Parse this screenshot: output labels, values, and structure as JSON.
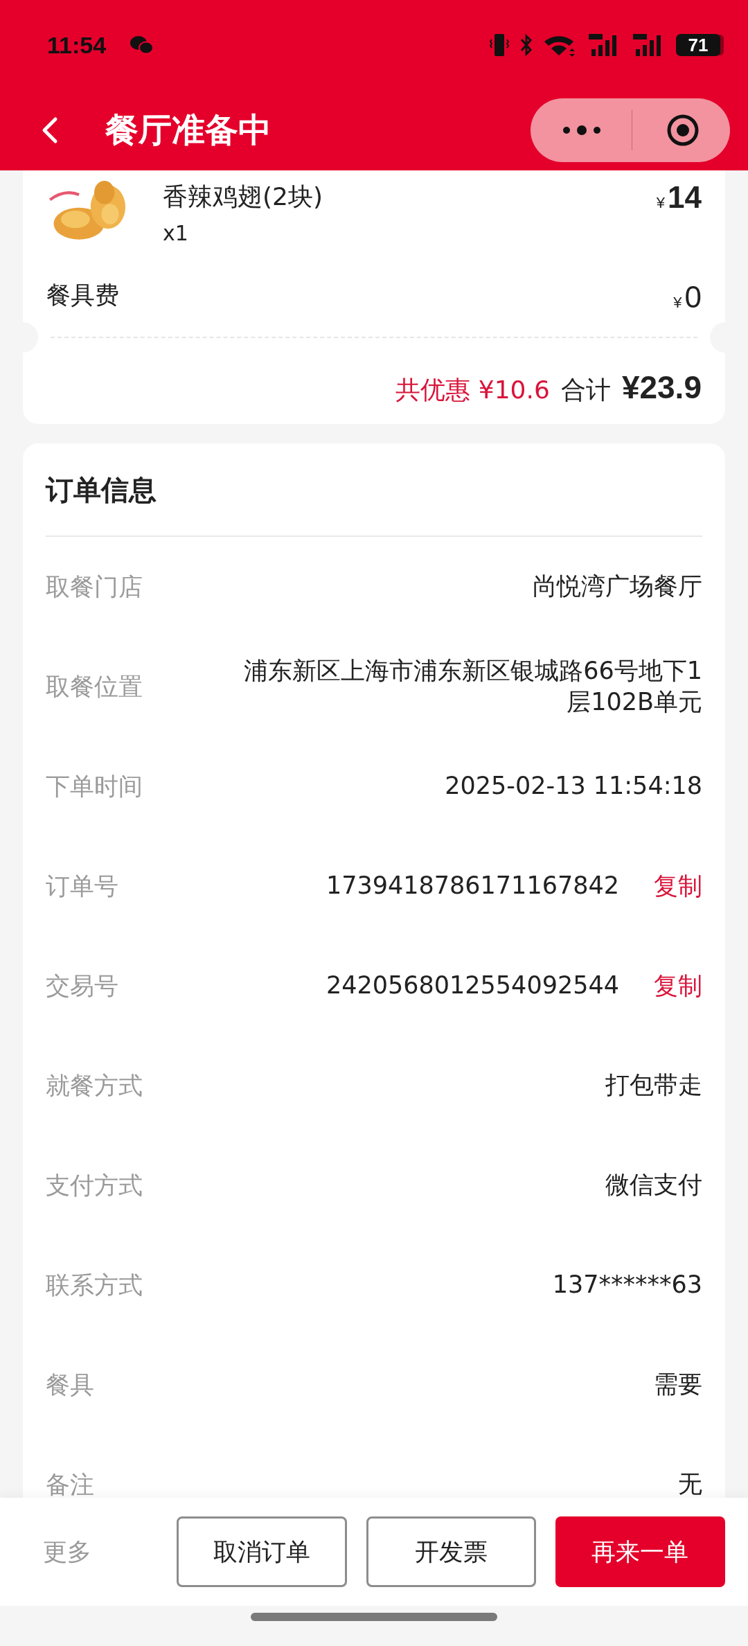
{
  "status_bar": {
    "time": "11:54",
    "battery": "71"
  },
  "nav": {
    "title": "餐厅准备中"
  },
  "items": [
    {
      "kind": "picture",
      "name": "香辣鸡翅(2块)",
      "quantity": "x1",
      "currency": "¥",
      "price": "14"
    }
  ],
  "fee": {
    "label": "餐具费",
    "currency": "¥",
    "amount": "0"
  },
  "summary": {
    "discount": "共优惠 ¥10.6",
    "total_label": "合计",
    "total": "¥23.9"
  },
  "order_info": {
    "title": "订单信息",
    "rows": [
      {
        "label": "取餐门店",
        "value": "尚悦湾广场餐厅"
      },
      {
        "label": "取餐位置",
        "value": "浦东新区上海市浦东新区银城路66号地下1层102B单元"
      },
      {
        "label": "下单时间",
        "value": "2025-02-13 11:54:18"
      },
      {
        "label": "订单号",
        "value": "1739418786171167842",
        "action": "复制"
      },
      {
        "label": "交易号",
        "value": "2420568012554092544",
        "action": "复制"
      },
      {
        "label": "就餐方式",
        "value": "打包带走"
      },
      {
        "label": "支付方式",
        "value": "微信支付"
      },
      {
        "label": "联系方式",
        "value": "137******63"
      },
      {
        "label": "餐具",
        "value": "需要"
      },
      {
        "label": "备注",
        "value": "无"
      }
    ]
  },
  "footer": {
    "more": "更多",
    "buttons": [
      {
        "label": "取消订单",
        "kind": "outline"
      },
      {
        "label": "开发票",
        "kind": "outline"
      },
      {
        "label": "再来一单",
        "kind": "primary"
      }
    ]
  }
}
